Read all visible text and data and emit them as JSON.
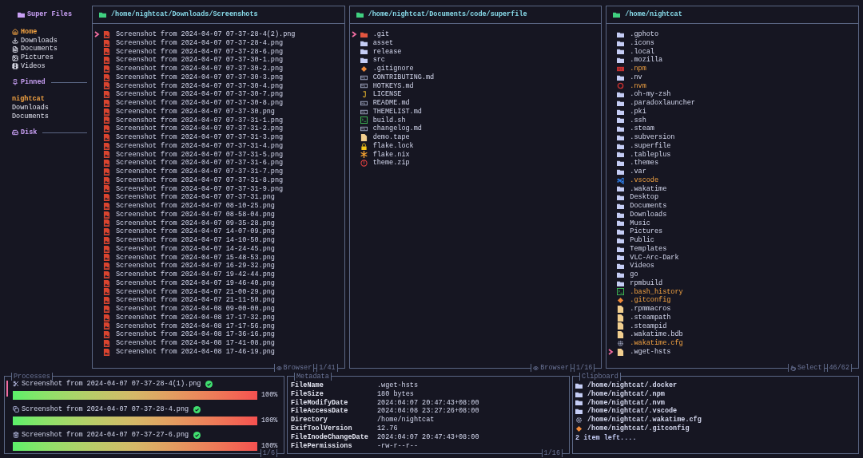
{
  "sidebar": {
    "title": "Super Files",
    "well_known": [
      {
        "label": "Home",
        "kind": "home",
        "selected": true
      },
      {
        "label": "Downloads",
        "kind": "downloads",
        "selected": false
      },
      {
        "label": "Documents",
        "kind": "documents",
        "selected": false
      },
      {
        "label": "Pictures",
        "kind": "pictures",
        "selected": false
      },
      {
        "label": "Videos",
        "kind": "videos",
        "selected": false
      }
    ],
    "pinned": {
      "title": "Pinned",
      "items": [
        {
          "label": "nightcat",
          "selected": true
        },
        {
          "label": "Downloads",
          "selected": false
        },
        {
          "label": "Documents",
          "selected": false
        }
      ]
    },
    "disk": {
      "title": "Disk"
    }
  },
  "panels": [
    {
      "path": "/home/nightcat/Downloads/Screenshots",
      "mode": {
        "label": "Browser",
        "kind": "browser"
      },
      "count": "1/41",
      "files": [
        {
          "name": "Screenshot from 2024-04-07 07-37-28-4(2).png",
          "kind": "image",
          "selected": false,
          "cursor": true
        },
        {
          "name": "Screenshot from 2024-04-07 07-37-28-4.png",
          "kind": "image",
          "selected": false,
          "cursor": false
        },
        {
          "name": "Screenshot from 2024-04-07 07-37-28-6.png",
          "kind": "image",
          "selected": false,
          "cursor": false
        },
        {
          "name": "Screenshot from 2024-04-07 07-37-30-1.png",
          "kind": "image",
          "selected": false,
          "cursor": false
        },
        {
          "name": "Screenshot from 2024-04-07 07-37-30-2.png",
          "kind": "image",
          "selected": false,
          "cursor": false
        },
        {
          "name": "Screenshot from 2024-04-07 07-37-30-3.png",
          "kind": "image",
          "selected": false,
          "cursor": false
        },
        {
          "name": "Screenshot from 2024-04-07 07-37-30-4.png",
          "kind": "image",
          "selected": false,
          "cursor": false
        },
        {
          "name": "Screenshot from 2024-04-07 07-37-30-7.png",
          "kind": "image",
          "selected": false,
          "cursor": false
        },
        {
          "name": "Screenshot from 2024-04-07 07-37-30-8.png",
          "kind": "image",
          "selected": false,
          "cursor": false
        },
        {
          "name": "Screenshot from 2024-04-07 07-37-30.png",
          "kind": "image",
          "selected": false,
          "cursor": false
        },
        {
          "name": "Screenshot from 2024-04-07 07-37-31-1.png",
          "kind": "image",
          "selected": false,
          "cursor": false
        },
        {
          "name": "Screenshot from 2024-04-07 07-37-31-2.png",
          "kind": "image",
          "selected": false,
          "cursor": false
        },
        {
          "name": "Screenshot from 2024-04-07 07-37-31-3.png",
          "kind": "image",
          "selected": false,
          "cursor": false
        },
        {
          "name": "Screenshot from 2024-04-07 07-37-31-4.png",
          "kind": "image",
          "selected": false,
          "cursor": false
        },
        {
          "name": "Screenshot from 2024-04-07 07-37-31-5.png",
          "kind": "image",
          "selected": false,
          "cursor": false
        },
        {
          "name": "Screenshot from 2024-04-07 07-37-31-6.png",
          "kind": "image",
          "selected": false,
          "cursor": false
        },
        {
          "name": "Screenshot from 2024-04-07 07-37-31-7.png",
          "kind": "image",
          "selected": false,
          "cursor": false
        },
        {
          "name": "Screenshot from 2024-04-07 07-37-31-8.png",
          "kind": "image",
          "selected": false,
          "cursor": false
        },
        {
          "name": "Screenshot from 2024-04-07 07-37-31-9.png",
          "kind": "image",
          "selected": false,
          "cursor": false
        },
        {
          "name": "Screenshot from 2024-04-07 07-37-31.png",
          "kind": "image",
          "selected": false,
          "cursor": false
        },
        {
          "name": "Screenshot from 2024-04-07 08-10-25.png",
          "kind": "image",
          "selected": false,
          "cursor": false
        },
        {
          "name": "Screenshot from 2024-04-07 08-58-04.png",
          "kind": "image",
          "selected": false,
          "cursor": false
        },
        {
          "name": "Screenshot from 2024-04-07 09-35-28.png",
          "kind": "image",
          "selected": false,
          "cursor": false
        },
        {
          "name": "Screenshot from 2024-04-07 14-07-09.png",
          "kind": "image",
          "selected": false,
          "cursor": false
        },
        {
          "name": "Screenshot from 2024-04-07 14-10-50.png",
          "kind": "image",
          "selected": false,
          "cursor": false
        },
        {
          "name": "Screenshot from 2024-04-07 14-24-45.png",
          "kind": "image",
          "selected": false,
          "cursor": false
        },
        {
          "name": "Screenshot from 2024-04-07 15-48-53.png",
          "kind": "image",
          "selected": false,
          "cursor": false
        },
        {
          "name": "Screenshot from 2024-04-07 16-29-32.png",
          "kind": "image",
          "selected": false,
          "cursor": false
        },
        {
          "name": "Screenshot from 2024-04-07 19-42-44.png",
          "kind": "image",
          "selected": false,
          "cursor": false
        },
        {
          "name": "Screenshot from 2024-04-07 19-46-40.png",
          "kind": "image",
          "selected": false,
          "cursor": false
        },
        {
          "name": "Screenshot from 2024-04-07 21-00-29.png",
          "kind": "image",
          "selected": false,
          "cursor": false
        },
        {
          "name": "Screenshot from 2024-04-07 21-11-50.png",
          "kind": "image",
          "selected": false,
          "cursor": false
        },
        {
          "name": "Screenshot from 2024-04-08 09-00-00.png",
          "kind": "image",
          "selected": false,
          "cursor": false
        },
        {
          "name": "Screenshot from 2024-04-08 17-17-32.png",
          "kind": "image",
          "selected": false,
          "cursor": false
        },
        {
          "name": "Screenshot from 2024-04-08 17-17-56.png",
          "kind": "image",
          "selected": false,
          "cursor": false
        },
        {
          "name": "Screenshot from 2024-04-08 17-36-16.png",
          "kind": "image",
          "selected": false,
          "cursor": false
        },
        {
          "name": "Screenshot from 2024-04-08 17-41-08.png",
          "kind": "image",
          "selected": false,
          "cursor": false
        },
        {
          "name": "Screenshot from 2024-04-08 17-46-19.png",
          "kind": "image",
          "selected": false,
          "cursor": false
        }
      ]
    },
    {
      "path": "/home/nightcat/Documents/code/superfile",
      "mode": {
        "label": "Browser",
        "kind": "browser"
      },
      "count": "1/16",
      "files": [
        {
          "name": ".git",
          "kind": "git-folder",
          "selected": false,
          "cursor": true
        },
        {
          "name": "asset",
          "kind": "folder",
          "selected": false,
          "cursor": false
        },
        {
          "name": "release",
          "kind": "folder",
          "selected": false,
          "cursor": false
        },
        {
          "name": "src",
          "kind": "folder",
          "selected": false,
          "cursor": false
        },
        {
          "name": ".gitignore",
          "kind": "git",
          "selected": false,
          "cursor": false
        },
        {
          "name": "CONTRIBUTING.md",
          "kind": "markdown",
          "selected": false,
          "cursor": false
        },
        {
          "name": "HOTKEYS.md",
          "kind": "markdown",
          "selected": false,
          "cursor": false
        },
        {
          "name": "LICENSE",
          "kind": "license",
          "selected": false,
          "cursor": false
        },
        {
          "name": "README.md",
          "kind": "markdown",
          "selected": false,
          "cursor": false
        },
        {
          "name": "THEMELIST.md",
          "kind": "markdown",
          "selected": false,
          "cursor": false
        },
        {
          "name": "build.sh",
          "kind": "shell",
          "selected": false,
          "cursor": false
        },
        {
          "name": "changelog.md",
          "kind": "markdown",
          "selected": false,
          "cursor": false
        },
        {
          "name": "demo.tape",
          "kind": "file",
          "selected": false,
          "cursor": false
        },
        {
          "name": "flake.lock",
          "kind": "lock",
          "selected": false,
          "cursor": false
        },
        {
          "name": "flake.nix",
          "kind": "nix",
          "selected": false,
          "cursor": false
        },
        {
          "name": "theme.zip",
          "kind": "zip",
          "selected": false,
          "cursor": false
        }
      ]
    },
    {
      "path": "/home/nightcat",
      "mode": {
        "label": "Select",
        "kind": "select"
      },
      "count": "46/62",
      "files": [
        {
          "name": ".gphoto",
          "kind": "folder",
          "selected": false,
          "cursor": false
        },
        {
          "name": ".icons",
          "kind": "folder",
          "selected": false,
          "cursor": false
        },
        {
          "name": ".local",
          "kind": "folder",
          "selected": false,
          "cursor": false
        },
        {
          "name": ".mozilla",
          "kind": "folder",
          "selected": false,
          "cursor": false
        },
        {
          "name": ".npm",
          "kind": "npm",
          "selected": true,
          "cursor": false
        },
        {
          "name": ".nv",
          "kind": "folder",
          "selected": false,
          "cursor": false
        },
        {
          "name": ".nvm",
          "kind": "nvm",
          "selected": true,
          "cursor": false
        },
        {
          "name": ".oh-my-zsh",
          "kind": "folder",
          "selected": false,
          "cursor": false
        },
        {
          "name": ".paradoxlauncher",
          "kind": "folder",
          "selected": false,
          "cursor": false
        },
        {
          "name": ".pki",
          "kind": "folder",
          "selected": false,
          "cursor": false
        },
        {
          "name": ".ssh",
          "kind": "folder",
          "selected": false,
          "cursor": false
        },
        {
          "name": ".steam",
          "kind": "folder",
          "selected": false,
          "cursor": false
        },
        {
          "name": ".subversion",
          "kind": "folder",
          "selected": false,
          "cursor": false
        },
        {
          "name": ".superfile",
          "kind": "folder",
          "selected": false,
          "cursor": false
        },
        {
          "name": ".tableplus",
          "kind": "folder",
          "selected": false,
          "cursor": false
        },
        {
          "name": ".themes",
          "kind": "folder",
          "selected": false,
          "cursor": false
        },
        {
          "name": ".var",
          "kind": "folder",
          "selected": false,
          "cursor": false
        },
        {
          "name": ".vscode",
          "kind": "vscode",
          "selected": true,
          "cursor": false
        },
        {
          "name": ".wakatime",
          "kind": "folder",
          "selected": false,
          "cursor": false
        },
        {
          "name": "Desktop",
          "kind": "folder",
          "selected": false,
          "cursor": false
        },
        {
          "name": "Documents",
          "kind": "folder",
          "selected": false,
          "cursor": false
        },
        {
          "name": "Downloads",
          "kind": "folder",
          "selected": false,
          "cursor": false
        },
        {
          "name": "Music",
          "kind": "folder",
          "selected": false,
          "cursor": false
        },
        {
          "name": "Pictures",
          "kind": "folder",
          "selected": false,
          "cursor": false
        },
        {
          "name": "Public",
          "kind": "folder",
          "selected": false,
          "cursor": false
        },
        {
          "name": "Templates",
          "kind": "folder",
          "selected": false,
          "cursor": false
        },
        {
          "name": "VLC-Arc-Dark",
          "kind": "folder",
          "selected": false,
          "cursor": false
        },
        {
          "name": "Videos",
          "kind": "folder",
          "selected": false,
          "cursor": false
        },
        {
          "name": "go",
          "kind": "folder",
          "selected": false,
          "cursor": false
        },
        {
          "name": "rpmbuild",
          "kind": "folder",
          "selected": false,
          "cursor": false
        },
        {
          "name": ".bash_history",
          "kind": "shell",
          "selected": true,
          "cursor": false
        },
        {
          "name": ".gitconfig",
          "kind": "git",
          "selected": true,
          "cursor": false
        },
        {
          "name": ".rpmmacros",
          "kind": "file",
          "selected": false,
          "cursor": false
        },
        {
          "name": ".steampath",
          "kind": "file",
          "selected": false,
          "cursor": false
        },
        {
          "name": ".steampid",
          "kind": "file",
          "selected": false,
          "cursor": false
        },
        {
          "name": ".wakatime.bdb",
          "kind": "file",
          "selected": false,
          "cursor": false
        },
        {
          "name": ".wakatime.cfg",
          "kind": "config",
          "selected": true,
          "cursor": false
        },
        {
          "name": ".wget-hsts",
          "kind": "file",
          "selected": false,
          "cursor": true
        }
      ]
    }
  ],
  "processes": {
    "title": "Processes",
    "count": "1/6",
    "items": [
      {
        "kind": "cut",
        "name": "Screenshot from 2024-04-07 07-37-28-4(1).png",
        "done": true,
        "level": 1,
        "reading": "100%",
        "selected": true
      },
      {
        "kind": "copy",
        "name": "Screenshot from 2024-04-07 07-37-28-4.png",
        "done": true,
        "level": 1,
        "reading": "100%",
        "selected": false
      },
      {
        "kind": "delete",
        "name": "Screenshot from 2024-04-07 07-37-27-6.png",
        "done": true,
        "level": 1,
        "reading": "100%",
        "selected": false
      }
    ]
  },
  "metadata": {
    "title": "Metadata",
    "count": "1/16",
    "rows": [
      {
        "key": "FileName",
        "value": ".wget-hsts"
      },
      {
        "key": "FileSize",
        "value": "180 bytes"
      },
      {
        "key": "FileModifyDate",
        "value": "2024:04:07 20:47:43+08:00"
      },
      {
        "key": "FileAccessDate",
        "value": "2024:04:08 23:27:26+08:00"
      },
      {
        "key": "Directory",
        "value": "/home/nightcat"
      },
      {
        "key": "ExifToolVersion",
        "value": "12.76"
      },
      {
        "key": "FileInodeChangeDate",
        "value": "2024:04:07 20:47:43+08:00"
      },
      {
        "key": "FilePermissions",
        "value": "-rw-r--r--"
      }
    ]
  },
  "clipboard": {
    "title": "Clipboard",
    "items": [
      {
        "kind": "folder",
        "path": "/home/nightcat/.docker"
      },
      {
        "kind": "folder",
        "path": "/home/nightcat/.npm"
      },
      {
        "kind": "folder",
        "path": "/home/nightcat/.nvm"
      },
      {
        "kind": "folder",
        "path": "/home/nightcat/.vscode"
      },
      {
        "kind": "config",
        "path": "/home/nightcat/.wakatime.cfg"
      },
      {
        "kind": "git",
        "path": "/home/nightcat/.gitconfig"
      }
    ],
    "more": "2 item left...."
  }
}
